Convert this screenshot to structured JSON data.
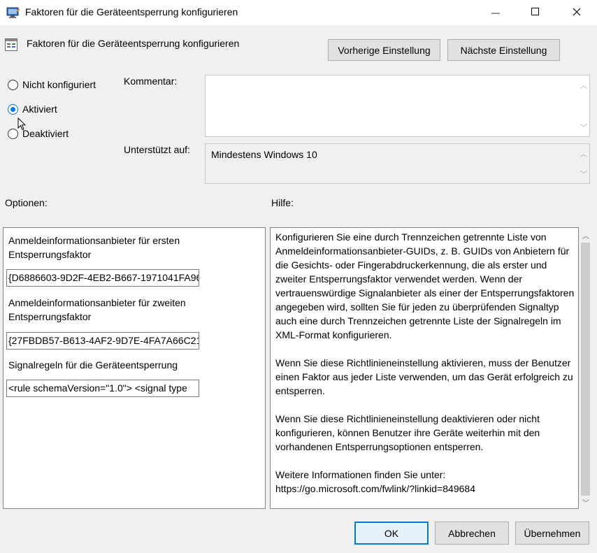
{
  "window": {
    "title": "Faktoren für die Geräteentsperrung konfigurieren",
    "minimize_glyph": "—",
    "maximize_glyph": "☐",
    "close_glyph": "✕"
  },
  "header": {
    "policy_title": "Faktoren für die Geräteentsperrung konfigurieren",
    "prev_label": "Vorherige Einstellung",
    "next_label": "Nächste Einstellung"
  },
  "state": {
    "options": [
      {
        "label": "Nicht konfiguriert",
        "checked": false
      },
      {
        "label": "Aktiviert",
        "checked": true
      },
      {
        "label": "Deaktiviert",
        "checked": false
      }
    ]
  },
  "comment": {
    "label": "Kommentar:",
    "value": ""
  },
  "supported": {
    "label": "Unterstützt auf:",
    "value": "Mindestens Windows 10"
  },
  "options_section": {
    "heading": "Optionen:",
    "first_factor_label": "Anmeldeinformationsanbieter für ersten Entsperrungsfaktor",
    "first_factor_value": "{D6886603-9D2F-4EB2-B667-1971041FA96",
    "second_factor_label": "Anmeldeinformationsanbieter für zweiten Entsperrungsfaktor",
    "second_factor_value": "{27FBDB57-B613-4AF2-9D7E-4FA7A66C21",
    "signal_rules_label": "Signalregeln für die Geräteentsperrung",
    "signal_rules_value": "<rule schemaVersion=\"1.0\"> <signal type"
  },
  "help": {
    "heading": "Hilfe:",
    "paragraphs": [
      "Konfigurieren Sie eine durch Trennzeichen getrennte Liste von Anmeldeinformationsanbieter-GUIDs, z. B. GUIDs von Anbietern für die Gesichts- oder Fingerabdruckerkennung, die als erster und zweiter Entsperrungsfaktor verwendet werden. Wenn der vertrauenswürdige Signalanbieter als einer der Entsperrungsfaktoren angegeben wird, sollten Sie für jeden zu überprüfenden Signaltyp auch eine durch Trennzeichen getrennte Liste der Signalregeln im XML-Format konfigurieren.",
      "Wenn Sie diese Richtlinieneinstellung aktivieren, muss der Benutzer einen Faktor aus jeder Liste verwenden, um das Gerät erfolgreich zu entsperren.",
      "Wenn Sie diese Richtlinieneinstellung deaktivieren oder nicht konfigurieren, können Benutzer ihre Geräte weiterhin mit den vorhandenen Entsperrungsoptionen entsperren.",
      "Weitere Informationen finden Sie unter: https://go.microsoft.com/fwlink/?linkid=849684"
    ]
  },
  "footer": {
    "ok_label": "OK",
    "cancel_label": "Abbrechen",
    "apply_label": "Übernehmen"
  },
  "colors": {
    "accent": "#0078d7",
    "dialog_bg": "#f0f0f0"
  }
}
